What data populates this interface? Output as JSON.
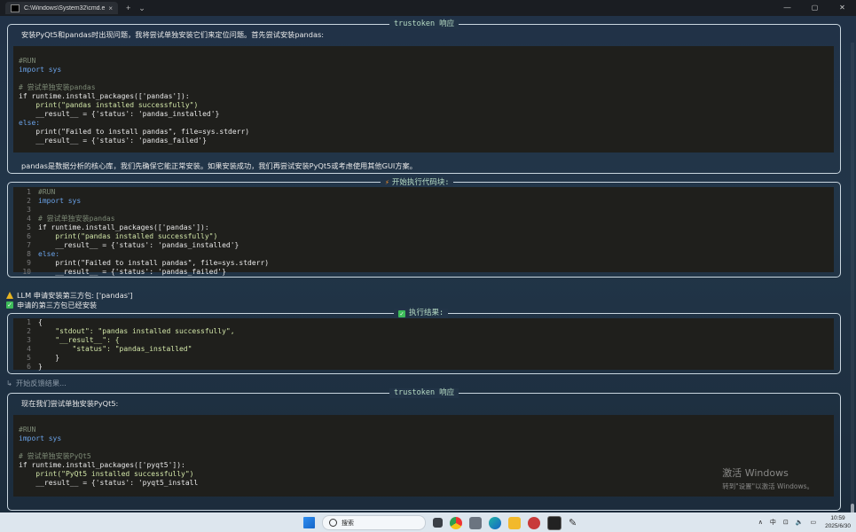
{
  "window": {
    "tab_title": "C:\\Windows\\System32\\cmd.e",
    "tab_close": "×",
    "new_tab": "+",
    "dropdown": "⌄",
    "controls": {
      "minimize": "—",
      "maximize": "▢",
      "close": "✕"
    }
  },
  "panel1": {
    "title": "trustoken 响应",
    "intro": "安装PyQt5和pandas时出现问题，我将尝试单独安装它们来定位问题。首先尝试安装pandas:",
    "footer": "pandas是数据分析的核心库，我们先确保它能正常安装。如果安装成功，我们再尝试安装PyQt5或考虑使用其他GUI方案。",
    "code": [
      {
        "k": "cm",
        "t": "#RUN"
      },
      {
        "k": "kw",
        "t": "import sys"
      },
      {
        "k": "op",
        "t": ""
      },
      {
        "k": "cm",
        "t": "# 尝试单独安装pandas"
      },
      {
        "k": "op",
        "t": "if runtime.install_packages(['pandas']):"
      },
      {
        "k": "st",
        "t": "    print(\"pandas installed successfully\")"
      },
      {
        "k": "op",
        "t": "    __result__ = {'status': 'pandas_installed'}"
      },
      {
        "k": "kw",
        "t": "else:"
      },
      {
        "k": "op",
        "t": "    print(\"Failed to install pandas\", file=sys.stderr)"
      },
      {
        "k": "op",
        "t": "    __result__ = {'status': 'pandas_failed'}"
      }
    ]
  },
  "panel2": {
    "title": "开始执行代码块:",
    "code": [
      {
        "n": "1",
        "k": "cm",
        "t": "#RUN"
      },
      {
        "n": "2",
        "k": "kw",
        "t": "import sys"
      },
      {
        "n": "3",
        "k": "op",
        "t": ""
      },
      {
        "n": "4",
        "k": "cm",
        "t": "# 尝试单独安装pandas"
      },
      {
        "n": "5",
        "k": "op",
        "t": "if runtime.install_packages(['pandas']):"
      },
      {
        "n": "6",
        "k": "st",
        "t": "    print(\"pandas installed successfully\")"
      },
      {
        "n": "7",
        "k": "op",
        "t": "    __result__ = {'status': 'pandas_installed'}"
      },
      {
        "n": "8",
        "k": "kw",
        "t": "else:"
      },
      {
        "n": "9",
        "k": "op",
        "t": "    print(\"Failed to install pandas\", file=sys.stderr)"
      },
      {
        "n": "10",
        "k": "op",
        "t": "    __result__ = {'status': 'pandas_failed'}"
      }
    ]
  },
  "status": {
    "llm_request": "LLM 申请安装第三方包: ['pandas']",
    "installed": "申请的第三方包已经安装",
    "feedback": "开始反馈结果..."
  },
  "panel3": {
    "title": "执行结果:",
    "code": [
      {
        "n": "1",
        "k": "op",
        "t": "{"
      },
      {
        "n": "2",
        "k": "st",
        "t": "    \"stdout\": \"pandas installed successfully\","
      },
      {
        "n": "3",
        "k": "st",
        "t": "    \"__result__\": {"
      },
      {
        "n": "4",
        "k": "st",
        "t": "        \"status\": \"pandas_installed\""
      },
      {
        "n": "5",
        "k": "op",
        "t": "    }"
      },
      {
        "n": "6",
        "k": "op",
        "t": "}"
      }
    ]
  },
  "panel4": {
    "title": "trustoken 响应",
    "intro": "现在我们尝试单独安装PyQt5:",
    "code": [
      {
        "k": "cm",
        "t": "#RUN"
      },
      {
        "k": "kw",
        "t": "import sys"
      },
      {
        "k": "op",
        "t": ""
      },
      {
        "k": "cm",
        "t": "# 尝试单独安装PyQt5"
      },
      {
        "k": "op",
        "t": "if runtime.install_packages(['pyqt5']):"
      },
      {
        "k": "st",
        "t": "    print(\"PyQt5 installed successfully\")"
      },
      {
        "k": "op",
        "t": "    __result__ = {'status': 'pyqt5_install"
      }
    ]
  },
  "watermark": {
    "title": "激活 Windows",
    "subtitle": "转到\"设置\"以激活 Windows。"
  },
  "taskbar": {
    "search_placeholder": "搜索",
    "tray_chevron": "∧",
    "tray_lang": "中",
    "tray_network": "⊡",
    "tray_volume": "🔈",
    "tray_battery": "▭",
    "time": "10:59",
    "date": "2025/6/30"
  },
  "colors": {
    "accent_green": "#b7dcc4",
    "keyword": "#6aa2e8",
    "string": "#d2e6a8",
    "comment": "#7d8a76"
  }
}
